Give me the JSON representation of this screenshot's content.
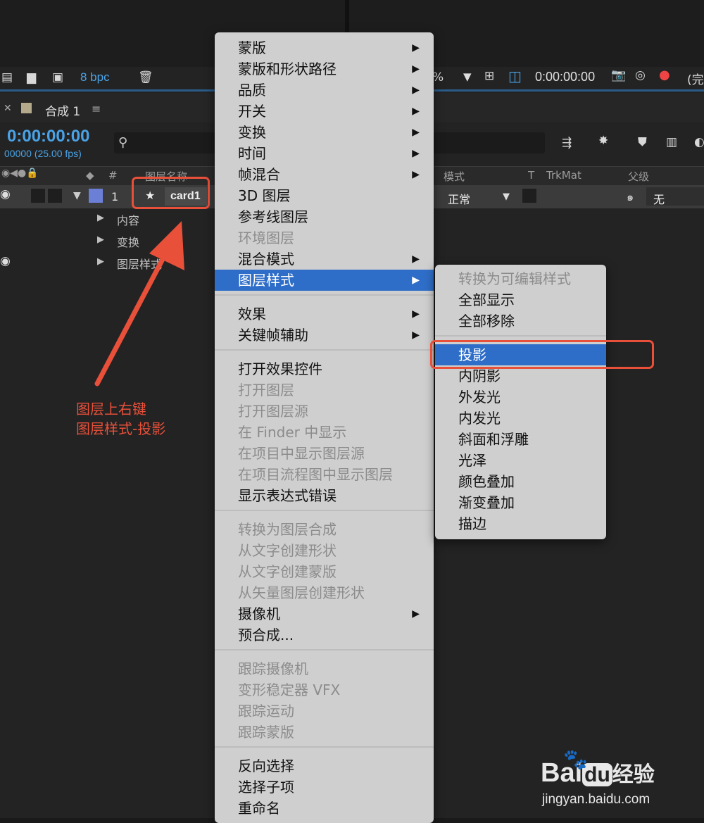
{
  "toolbar": {
    "bpc": "8 bpc",
    "zoom_fragment": "%",
    "timecode": "0:00:00:00",
    "status_fragment": "(完"
  },
  "panel": {
    "tab_name": "合成 1",
    "current_time": "0:00:00:00",
    "frame_info": "00000 (25.00 fps)"
  },
  "columns": {
    "number": "#",
    "layer_name": "图层名称",
    "mode": "模式",
    "t": "T",
    "trkmat": "TrkMat",
    "parent": "父级"
  },
  "layer": {
    "index": "1",
    "name": "card1",
    "mode": "正常",
    "parent": "无",
    "children": [
      "内容",
      "变换",
      "图层样式"
    ]
  },
  "context_menu": {
    "items": [
      {
        "label": "蒙版",
        "submenu": true,
        "enabled": true
      },
      {
        "label": "蒙版和形状路径",
        "submenu": true,
        "enabled": true
      },
      {
        "label": "品质",
        "submenu": true,
        "enabled": true
      },
      {
        "label": "开关",
        "submenu": true,
        "enabled": true
      },
      {
        "label": "变换",
        "submenu": true,
        "enabled": true
      },
      {
        "label": "时间",
        "submenu": true,
        "enabled": true
      },
      {
        "label": "帧混合",
        "submenu": true,
        "enabled": true
      },
      {
        "label": "3D 图层",
        "submenu": false,
        "enabled": true
      },
      {
        "label": "参考线图层",
        "submenu": false,
        "enabled": true
      },
      {
        "label": "环境图层",
        "submenu": false,
        "enabled": false
      },
      {
        "label": "混合模式",
        "submenu": true,
        "enabled": true
      },
      {
        "label": "图层样式",
        "submenu": true,
        "enabled": true,
        "highlighted": true
      },
      {
        "label": "效果",
        "submenu": true,
        "enabled": true
      },
      {
        "label": "关键帧辅助",
        "submenu": true,
        "enabled": true
      },
      {
        "label": "打开效果控件",
        "submenu": false,
        "enabled": true
      },
      {
        "label": "打开图层",
        "submenu": false,
        "enabled": false
      },
      {
        "label": "打开图层源",
        "submenu": false,
        "enabled": false
      },
      {
        "label": "在 Finder 中显示",
        "submenu": false,
        "enabled": false
      },
      {
        "label": "在项目中显示图层源",
        "submenu": false,
        "enabled": false
      },
      {
        "label": "在项目流程图中显示图层",
        "submenu": false,
        "enabled": false
      },
      {
        "label": "显示表达式错误",
        "submenu": false,
        "enabled": true
      },
      {
        "label": "转换为图层合成",
        "submenu": false,
        "enabled": false
      },
      {
        "label": "从文字创建形状",
        "submenu": false,
        "enabled": false
      },
      {
        "label": "从文字创建蒙版",
        "submenu": false,
        "enabled": false
      },
      {
        "label": "从矢量图层创建形状",
        "submenu": false,
        "enabled": false
      },
      {
        "label": "摄像机",
        "submenu": true,
        "enabled": true
      },
      {
        "label": "预合成...",
        "submenu": false,
        "enabled": true
      },
      {
        "label": "跟踪摄像机",
        "submenu": false,
        "enabled": false
      },
      {
        "label": "变形稳定器 VFX",
        "submenu": false,
        "enabled": false
      },
      {
        "label": "跟踪运动",
        "submenu": false,
        "enabled": false
      },
      {
        "label": "跟踪蒙版",
        "submenu": false,
        "enabled": false
      },
      {
        "label": "反向选择",
        "submenu": false,
        "enabled": true
      },
      {
        "label": "选择子项",
        "submenu": false,
        "enabled": true
      },
      {
        "label": "重命名",
        "submenu": false,
        "enabled": true
      }
    ]
  },
  "submenu": {
    "items": [
      {
        "label": "转换为可编辑样式",
        "enabled": false
      },
      {
        "label": "全部显示",
        "enabled": true
      },
      {
        "label": "全部移除",
        "enabled": true
      },
      {
        "label": "投影",
        "enabled": true,
        "highlighted": true
      },
      {
        "label": "内阴影",
        "enabled": true
      },
      {
        "label": "外发光",
        "enabled": true
      },
      {
        "label": "内发光",
        "enabled": true
      },
      {
        "label": "斜面和浮雕",
        "enabled": true
      },
      {
        "label": "光泽",
        "enabled": true
      },
      {
        "label": "颜色叠加",
        "enabled": true
      },
      {
        "label": "渐变叠加",
        "enabled": true
      },
      {
        "label": "描边",
        "enabled": true
      }
    ]
  },
  "annotation": {
    "line1": "图层上右键",
    "line2": "图层样式-投影"
  },
  "watermark": {
    "brand": "Bai",
    "brand2": "du",
    "suffix": "经验",
    "url": "jingyan.baidu.com"
  },
  "colors": {
    "accent_blue": "#4aa3e6",
    "highlight": "#2f6ec8",
    "annotation_red": "#e8503a"
  }
}
